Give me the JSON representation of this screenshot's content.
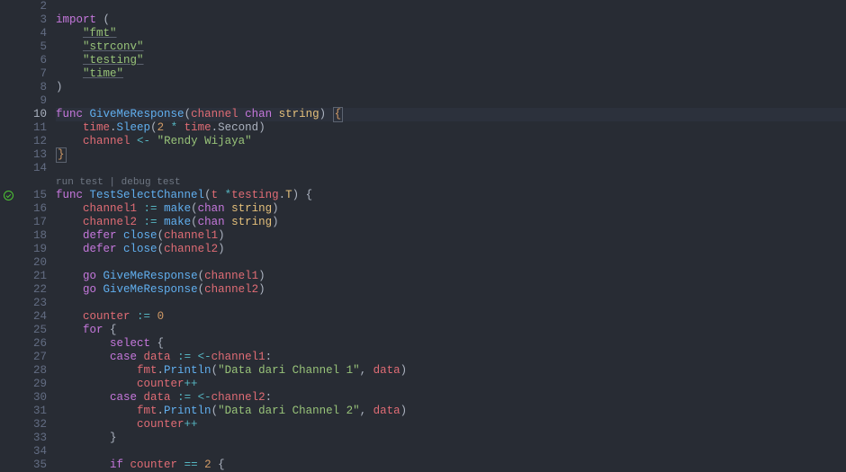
{
  "codelens": {
    "run": "run test",
    "debug": "debug test"
  },
  "lines": [
    {
      "n": 2,
      "i": 0,
      "t": []
    },
    {
      "n": 3,
      "i": 0,
      "t": [
        [
          "kw",
          "import"
        ],
        [
          "p",
          " ("
        ]
      ]
    },
    {
      "n": 4,
      "i": 1,
      "t": [
        [
          "strU",
          "\"fmt\""
        ]
      ]
    },
    {
      "n": 5,
      "i": 1,
      "t": [
        [
          "strU",
          "\"strconv\""
        ]
      ]
    },
    {
      "n": 6,
      "i": 1,
      "t": [
        [
          "strU",
          "\"testing\""
        ]
      ]
    },
    {
      "n": 7,
      "i": 1,
      "t": [
        [
          "strU",
          "\"time\""
        ]
      ]
    },
    {
      "n": 8,
      "i": 0,
      "t": [
        [
          "p",
          ")"
        ]
      ]
    },
    {
      "n": 9,
      "i": 0,
      "t": []
    },
    {
      "n": 10,
      "i": 0,
      "hl": true,
      "t": [
        [
          "kw",
          "func"
        ],
        [
          "nm",
          " "
        ],
        [
          "fn",
          "GiveMeResponse"
        ],
        [
          "p",
          "("
        ],
        [
          "id",
          "channel"
        ],
        [
          "nm",
          " "
        ],
        [
          "kw",
          "chan"
        ],
        [
          "nm",
          " "
        ],
        [
          "typ",
          "string"
        ],
        [
          "p",
          ") "
        ],
        [
          "bo",
          "{"
        ]
      ]
    },
    {
      "n": 11,
      "i": 1,
      "fold": true,
      "t": [
        [
          "id",
          "time"
        ],
        [
          "p",
          "."
        ],
        [
          "fn",
          "Sleep"
        ],
        [
          "p",
          "("
        ],
        [
          "num",
          "2"
        ],
        [
          "nm",
          " "
        ],
        [
          "op",
          "*"
        ],
        [
          "nm",
          " "
        ],
        [
          "id",
          "time"
        ],
        [
          "p",
          "."
        ],
        [
          "nm",
          "Second"
        ],
        [
          "p",
          ")"
        ]
      ]
    },
    {
      "n": 12,
      "i": 1,
      "fold": true,
      "t": [
        [
          "id",
          "channel"
        ],
        [
          "nm",
          " "
        ],
        [
          "op",
          "<-"
        ],
        [
          "nm",
          " "
        ],
        [
          "str",
          "\"Rendy Wijaya\""
        ]
      ]
    },
    {
      "n": 13,
      "i": 0,
      "t": [
        [
          "bo",
          "}"
        ]
      ]
    },
    {
      "n": 14,
      "i": 0,
      "t": []
    },
    {
      "n": "",
      "lens": true
    },
    {
      "n": 15,
      "i": 0,
      "glyph": "pass",
      "t": [
        [
          "kw",
          "func"
        ],
        [
          "nm",
          " "
        ],
        [
          "fn",
          "TestSelectChannel"
        ],
        [
          "p",
          "("
        ],
        [
          "id",
          "t"
        ],
        [
          "nm",
          " "
        ],
        [
          "op",
          "*"
        ],
        [
          "id",
          "testing"
        ],
        [
          "p",
          "."
        ],
        [
          "typ",
          "T"
        ],
        [
          "p",
          ") {"
        ]
      ]
    },
    {
      "n": 16,
      "i": 1,
      "t": [
        [
          "id",
          "channel1"
        ],
        [
          "nm",
          " "
        ],
        [
          "op",
          ":="
        ],
        [
          "nm",
          " "
        ],
        [
          "fn",
          "make"
        ],
        [
          "p",
          "("
        ],
        [
          "kw",
          "chan"
        ],
        [
          "nm",
          " "
        ],
        [
          "typ",
          "string"
        ],
        [
          "p",
          ")"
        ]
      ]
    },
    {
      "n": 17,
      "i": 1,
      "t": [
        [
          "id",
          "channel2"
        ],
        [
          "nm",
          " "
        ],
        [
          "op",
          ":="
        ],
        [
          "nm",
          " "
        ],
        [
          "fn",
          "make"
        ],
        [
          "p",
          "("
        ],
        [
          "kw",
          "chan"
        ],
        [
          "nm",
          " "
        ],
        [
          "typ",
          "string"
        ],
        [
          "p",
          ")"
        ]
      ]
    },
    {
      "n": 18,
      "i": 1,
      "t": [
        [
          "kw",
          "defer"
        ],
        [
          "nm",
          " "
        ],
        [
          "fn",
          "close"
        ],
        [
          "p",
          "("
        ],
        [
          "id",
          "channel1"
        ],
        [
          "p",
          ")"
        ]
      ]
    },
    {
      "n": 19,
      "i": 1,
      "t": [
        [
          "kw",
          "defer"
        ],
        [
          "nm",
          " "
        ],
        [
          "fn",
          "close"
        ],
        [
          "p",
          "("
        ],
        [
          "id",
          "channel2"
        ],
        [
          "p",
          ")"
        ]
      ]
    },
    {
      "n": 20,
      "i": 0,
      "t": []
    },
    {
      "n": 21,
      "i": 1,
      "t": [
        [
          "kw",
          "go"
        ],
        [
          "nm",
          " "
        ],
        [
          "fn",
          "GiveMeResponse"
        ],
        [
          "p",
          "("
        ],
        [
          "id",
          "channel1"
        ],
        [
          "p",
          ")"
        ]
      ]
    },
    {
      "n": 22,
      "i": 1,
      "t": [
        [
          "kw",
          "go"
        ],
        [
          "nm",
          " "
        ],
        [
          "fn",
          "GiveMeResponse"
        ],
        [
          "p",
          "("
        ],
        [
          "id",
          "channel2"
        ],
        [
          "p",
          ")"
        ]
      ]
    },
    {
      "n": 23,
      "i": 0,
      "t": []
    },
    {
      "n": 24,
      "i": 1,
      "t": [
        [
          "id",
          "counter"
        ],
        [
          "nm",
          " "
        ],
        [
          "op",
          ":="
        ],
        [
          "nm",
          " "
        ],
        [
          "num",
          "0"
        ]
      ]
    },
    {
      "n": 25,
      "i": 1,
      "t": [
        [
          "kw",
          "for"
        ],
        [
          "p",
          " {"
        ]
      ]
    },
    {
      "n": 26,
      "i": 2,
      "t": [
        [
          "kw",
          "select"
        ],
        [
          "p",
          " {"
        ]
      ]
    },
    {
      "n": 27,
      "i": 2,
      "t": [
        [
          "kw",
          "case"
        ],
        [
          "nm",
          " "
        ],
        [
          "id",
          "data"
        ],
        [
          "nm",
          " "
        ],
        [
          "op",
          ":="
        ],
        [
          "nm",
          " "
        ],
        [
          "op",
          "<-"
        ],
        [
          "id",
          "channel1"
        ],
        [
          "p",
          ":"
        ]
      ]
    },
    {
      "n": 28,
      "i": 3,
      "t": [
        [
          "id",
          "fmt"
        ],
        [
          "p",
          "."
        ],
        [
          "fn",
          "Println"
        ],
        [
          "p",
          "("
        ],
        [
          "str",
          "\"Data dari Channel 1\""
        ],
        [
          "p",
          ", "
        ],
        [
          "id",
          "data"
        ],
        [
          "p",
          ")"
        ]
      ]
    },
    {
      "n": 29,
      "i": 3,
      "t": [
        [
          "id",
          "counter"
        ],
        [
          "op",
          "++"
        ]
      ]
    },
    {
      "n": 30,
      "i": 2,
      "t": [
        [
          "kw",
          "case"
        ],
        [
          "nm",
          " "
        ],
        [
          "id",
          "data"
        ],
        [
          "nm",
          " "
        ],
        [
          "op",
          ":="
        ],
        [
          "nm",
          " "
        ],
        [
          "op",
          "<-"
        ],
        [
          "id",
          "channel2"
        ],
        [
          "p",
          ":"
        ]
      ]
    },
    {
      "n": 31,
      "i": 3,
      "t": [
        [
          "id",
          "fmt"
        ],
        [
          "p",
          "."
        ],
        [
          "fn",
          "Println"
        ],
        [
          "p",
          "("
        ],
        [
          "str",
          "\"Data dari Channel 2\""
        ],
        [
          "p",
          ", "
        ],
        [
          "id",
          "data"
        ],
        [
          "p",
          ")"
        ]
      ]
    },
    {
      "n": 32,
      "i": 3,
      "t": [
        [
          "id",
          "counter"
        ],
        [
          "op",
          "++"
        ]
      ]
    },
    {
      "n": 33,
      "i": 2,
      "t": [
        [
          "p",
          "}"
        ]
      ]
    },
    {
      "n": 34,
      "i": 0,
      "t": []
    },
    {
      "n": 35,
      "i": 2,
      "t": [
        [
          "kw",
          "if"
        ],
        [
          "nm",
          " "
        ],
        [
          "id",
          "counter"
        ],
        [
          "nm",
          " "
        ],
        [
          "op",
          "=="
        ],
        [
          "nm",
          " "
        ],
        [
          "num",
          "2"
        ],
        [
          "p",
          " {"
        ]
      ]
    }
  ]
}
